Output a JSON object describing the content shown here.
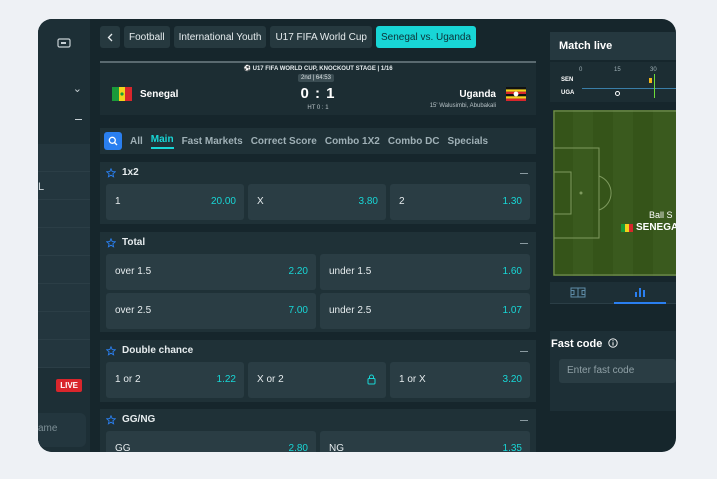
{
  "sidebar": {
    "live_badge": "LIVE",
    "search_placeholder": "ame"
  },
  "breadcrumbs": [
    "Football",
    "International Youth",
    "U17 FIFA World Cup",
    "Senegal vs. Uganda"
  ],
  "scoreboard": {
    "competition": "U17 FIFA WORLD CUP, KNOCKOUT STAGE | 1/16",
    "time": "2nd | 64:53",
    "home": "Senegal",
    "away": "Uganda",
    "score": "0 : 1",
    "halftime": "HT 0 : 1",
    "scorers": "15' Walusimbi, Abubakali"
  },
  "tabs": [
    "All",
    "Main",
    "Fast Markets",
    "Correct Score",
    "Combo 1X2",
    "Combo DC",
    "Specials"
  ],
  "markets": [
    {
      "title": "1x2",
      "odds": [
        {
          "label": "1",
          "value": "20.00"
        },
        {
          "label": "X",
          "value": "3.80"
        },
        {
          "label": "2",
          "value": "1.30"
        }
      ]
    },
    {
      "title": "Total",
      "odds": [
        {
          "label": "over 1.5",
          "value": "2.20"
        },
        {
          "label": "under 1.5",
          "value": "1.60"
        },
        {
          "label": "over 2.5",
          "value": "7.00"
        },
        {
          "label": "under 2.5",
          "value": "1.07"
        }
      ]
    },
    {
      "title": "Double chance",
      "odds": [
        {
          "label": "1 or 2",
          "value": "1.22"
        },
        {
          "label": "X or 2",
          "value": ""
        },
        {
          "label": "1 or X",
          "value": "3.20"
        }
      ]
    },
    {
      "title": "GG/NG",
      "odds": [
        {
          "label": "GG",
          "value": "2.80"
        },
        {
          "label": "NG",
          "value": "1.35"
        }
      ]
    }
  ],
  "match_live": {
    "title": "Match live",
    "teams": [
      "SEN",
      "UGA"
    ],
    "ticks": [
      "0",
      "15",
      "30"
    ],
    "pitch_text_1": "Ball S",
    "pitch_text_2": "SENEGA"
  },
  "fast_code": {
    "title": "Fast code",
    "placeholder": "Enter fast code"
  },
  "colors": {
    "accent": "#18d6d6",
    "live": "#d9262c",
    "panel": "#1f3137"
  },
  "icons": [
    "ticket-icon",
    "chevron-down-icon",
    "search-icon",
    "star-icon",
    "lock-icon",
    "info-icon",
    "pitch-icon",
    "stats-icon"
  ]
}
